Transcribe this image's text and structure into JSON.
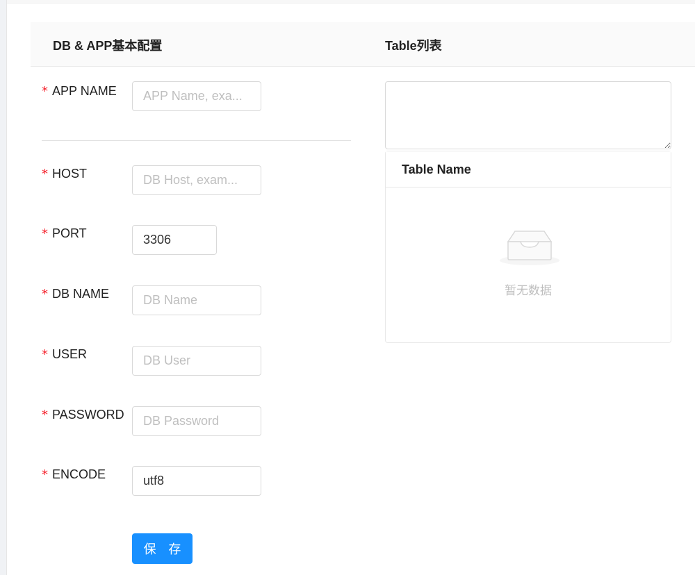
{
  "header": {
    "left_title": "DB & APP基本配置",
    "right_title": "Table列表"
  },
  "form": {
    "required_mark": "*",
    "app_name": {
      "label": "APP NAME",
      "placeholder": "APP Name, exa...",
      "value": ""
    },
    "host": {
      "label": "HOST",
      "placeholder": "DB Host, exam...",
      "value": ""
    },
    "port": {
      "label": "PORT",
      "placeholder": "",
      "value": "3306"
    },
    "db_name": {
      "label": "DB NAME",
      "placeholder": "DB Name",
      "value": ""
    },
    "user": {
      "label": "USER",
      "placeholder": "DB User",
      "value": ""
    },
    "password": {
      "label": "PASSWORD",
      "placeholder": "DB Password",
      "value": ""
    },
    "encode": {
      "label": "ENCODE",
      "placeholder": "",
      "value": "utf8"
    },
    "save_label": "保 存"
  },
  "table": {
    "textarea_value": "",
    "column_header": "Table Name",
    "empty_text": "暂无数据",
    "empty_icon": "inbox-empty-icon"
  },
  "colors": {
    "primary": "#1890ff",
    "required": "#f5222d",
    "border": "#d9d9d9"
  }
}
